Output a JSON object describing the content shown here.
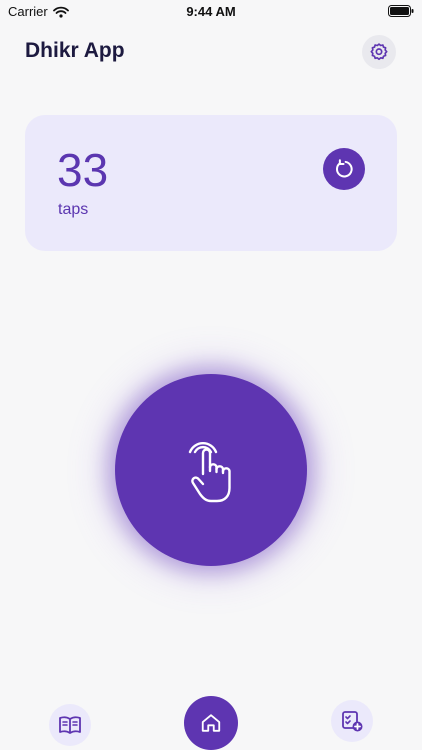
{
  "status_bar": {
    "carrier": "Carrier",
    "time": "9:44 AM"
  },
  "header": {
    "title": "Dhikr App"
  },
  "counter": {
    "value": "33",
    "label": "taps"
  },
  "colors": {
    "accent": "#5e35b1",
    "card": "#ebe9fb",
    "title": "#1d1a40"
  },
  "icons": {
    "settings": "gear-icon",
    "reset": "refresh-icon",
    "tap": "hand-pointer-icon",
    "library": "book-icon",
    "home": "home-icon",
    "add": "checklist-add-icon"
  }
}
